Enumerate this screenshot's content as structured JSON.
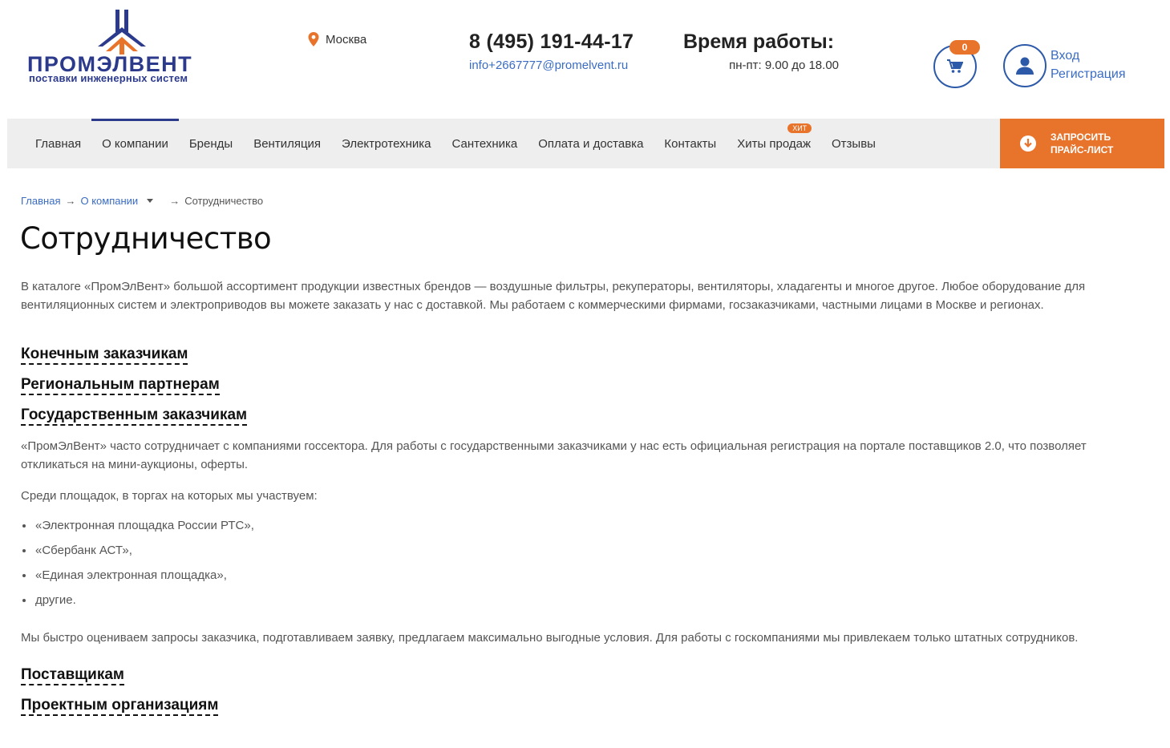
{
  "logo": {
    "name": "ПРОМЭЛВЕНТ",
    "tagline": "поставки инженерных систем"
  },
  "header": {
    "city": "Москва",
    "phone": "8 (495) 191-44-17",
    "email": "info+2667777@promelvent.ru",
    "hours_title": "Время работы:",
    "hours_value": "пн-пт: 9.00 до 18.00",
    "cart_count": "0",
    "login": "Вход",
    "register": "Регистрация"
  },
  "nav": {
    "items": [
      {
        "label": "Главная"
      },
      {
        "label": "О компании"
      },
      {
        "label": "Бренды"
      },
      {
        "label": "Вентиляция"
      },
      {
        "label": "Электротехника"
      },
      {
        "label": "Сантехника"
      },
      {
        "label": "Оплата и доставка"
      },
      {
        "label": "Контакты"
      },
      {
        "label": "Хиты продаж",
        "badge": "ХИТ"
      },
      {
        "label": "Отзывы"
      }
    ],
    "price_button": "ЗАПРОСИТЬ ПРАЙС-ЛИСТ"
  },
  "breadcrumb": {
    "home": "Главная",
    "section": "О компании",
    "current": "Сотрудничество",
    "arrow": "→"
  },
  "page": {
    "title": "Сотрудничество",
    "intro": "В каталоге «ПромЭлВент» большой ассортимент продукции известных брендов — воздушные фильтры, рекуператоры, вентиляторы, хладагенты и многое другое. Любое оборудование для вентиляционных систем и электроприводов вы можете заказать у нас с доставкой. Мы работаем с коммерческими фирмами, госзаказчиками, частными лицами в Москве и регионах.",
    "sections": [
      "Конечным заказчикам",
      "Региональным партнерам",
      "Государственным заказчикам"
    ],
    "gov_text": "«ПромЭлВент» часто сотрудничает с компаниями госсектора. Для работы с государственными заказчиками у нас есть официальная регистрация на портале поставщиков 2.0, что позволяет откликаться на мини-аукционы, оферты.",
    "platforms_intro": "Среди площадок, в торгах на которых мы участвуем:",
    "platforms": [
      "«Электронная площадка России РТС»,",
      "«Сбербанк АСТ»,",
      "«Единая электронная площадка»,",
      "другие."
    ],
    "gov_outro": "Мы быстро оцениваем запросы заказчика, подготавливаем заявку, предлагаем максимально выгодные условия. Для работы с госкомпаниями мы привлекаем только штатных сотрудников.",
    "sections_after": [
      "Поставщикам",
      "Проектным организациям"
    ]
  },
  "colors": {
    "brand_blue": "#2c3a8c",
    "link_blue": "#3a6cc4",
    "accent_orange": "#e8742c",
    "nav_bg": "#eeeeee"
  }
}
